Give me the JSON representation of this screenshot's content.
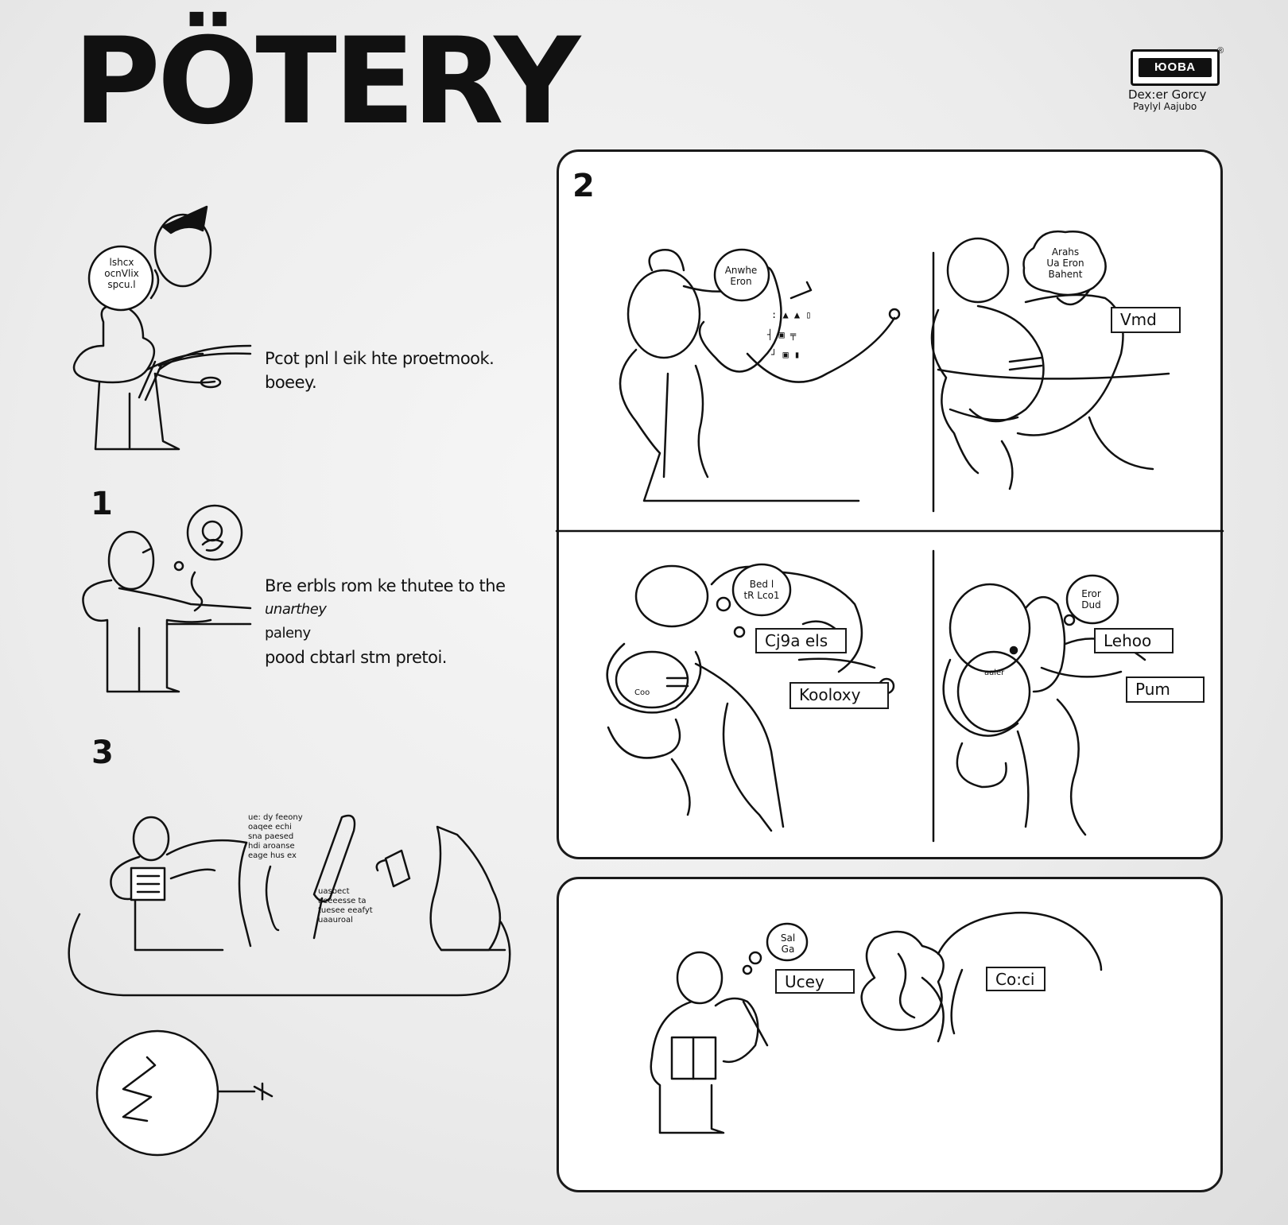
{
  "title": "PÖTERY",
  "logo": {
    "mark": "ЮОВА",
    "registered": "®",
    "line1": "Dex:er Gorcy",
    "line2": "Paylyl Aajubo"
  },
  "steps": {
    "intro_text": [
      "Pcot pnl l eik hte proetmook.",
      "boeey."
    ],
    "intro_bubble": [
      "lshcx",
      "ocnVlix",
      "spcu.l"
    ],
    "step1_number": "1",
    "step1_text": [
      "Bre erbls rom ke thutee to the",
      "unarthey",
      "paleny",
      "pood cbtarl stm pretoi."
    ],
    "step3_number": "3",
    "step3_note_top": [
      "ue: dy feeony",
      "oaqee echi",
      "sna paesed",
      "hdi aroanse",
      "eage hus ex"
    ],
    "step3_note_bottom": [
      "uasbect",
      "aeeeesse ta",
      "tuesee eeafyt",
      "uaauroal"
    ],
    "step2_number": "2"
  },
  "panel2": {
    "bubble_left": [
      "Anwhe",
      "Eron"
    ],
    "bubble_right": [
      "Arahs",
      "Ua Eron",
      "Bahent"
    ],
    "tag_right": "Vmd",
    "cell3_bubble": [
      "Bed l",
      "tR Lco1"
    ],
    "cell3_tag1": "Cj9a els",
    "cell3_tag2": "Kooloxy",
    "cell3_small": "Coo",
    "cell4_bubble": [
      "Eror",
      "Dud"
    ],
    "cell4_tag1": "Lehoo",
    "cell4_tag2": "Pum",
    "cell4_small": "aaler"
  },
  "panel3": {
    "bubble": [
      "Sal",
      "Ga"
    ],
    "tag_left": "Ucey",
    "tag_right": "Co:ci"
  }
}
